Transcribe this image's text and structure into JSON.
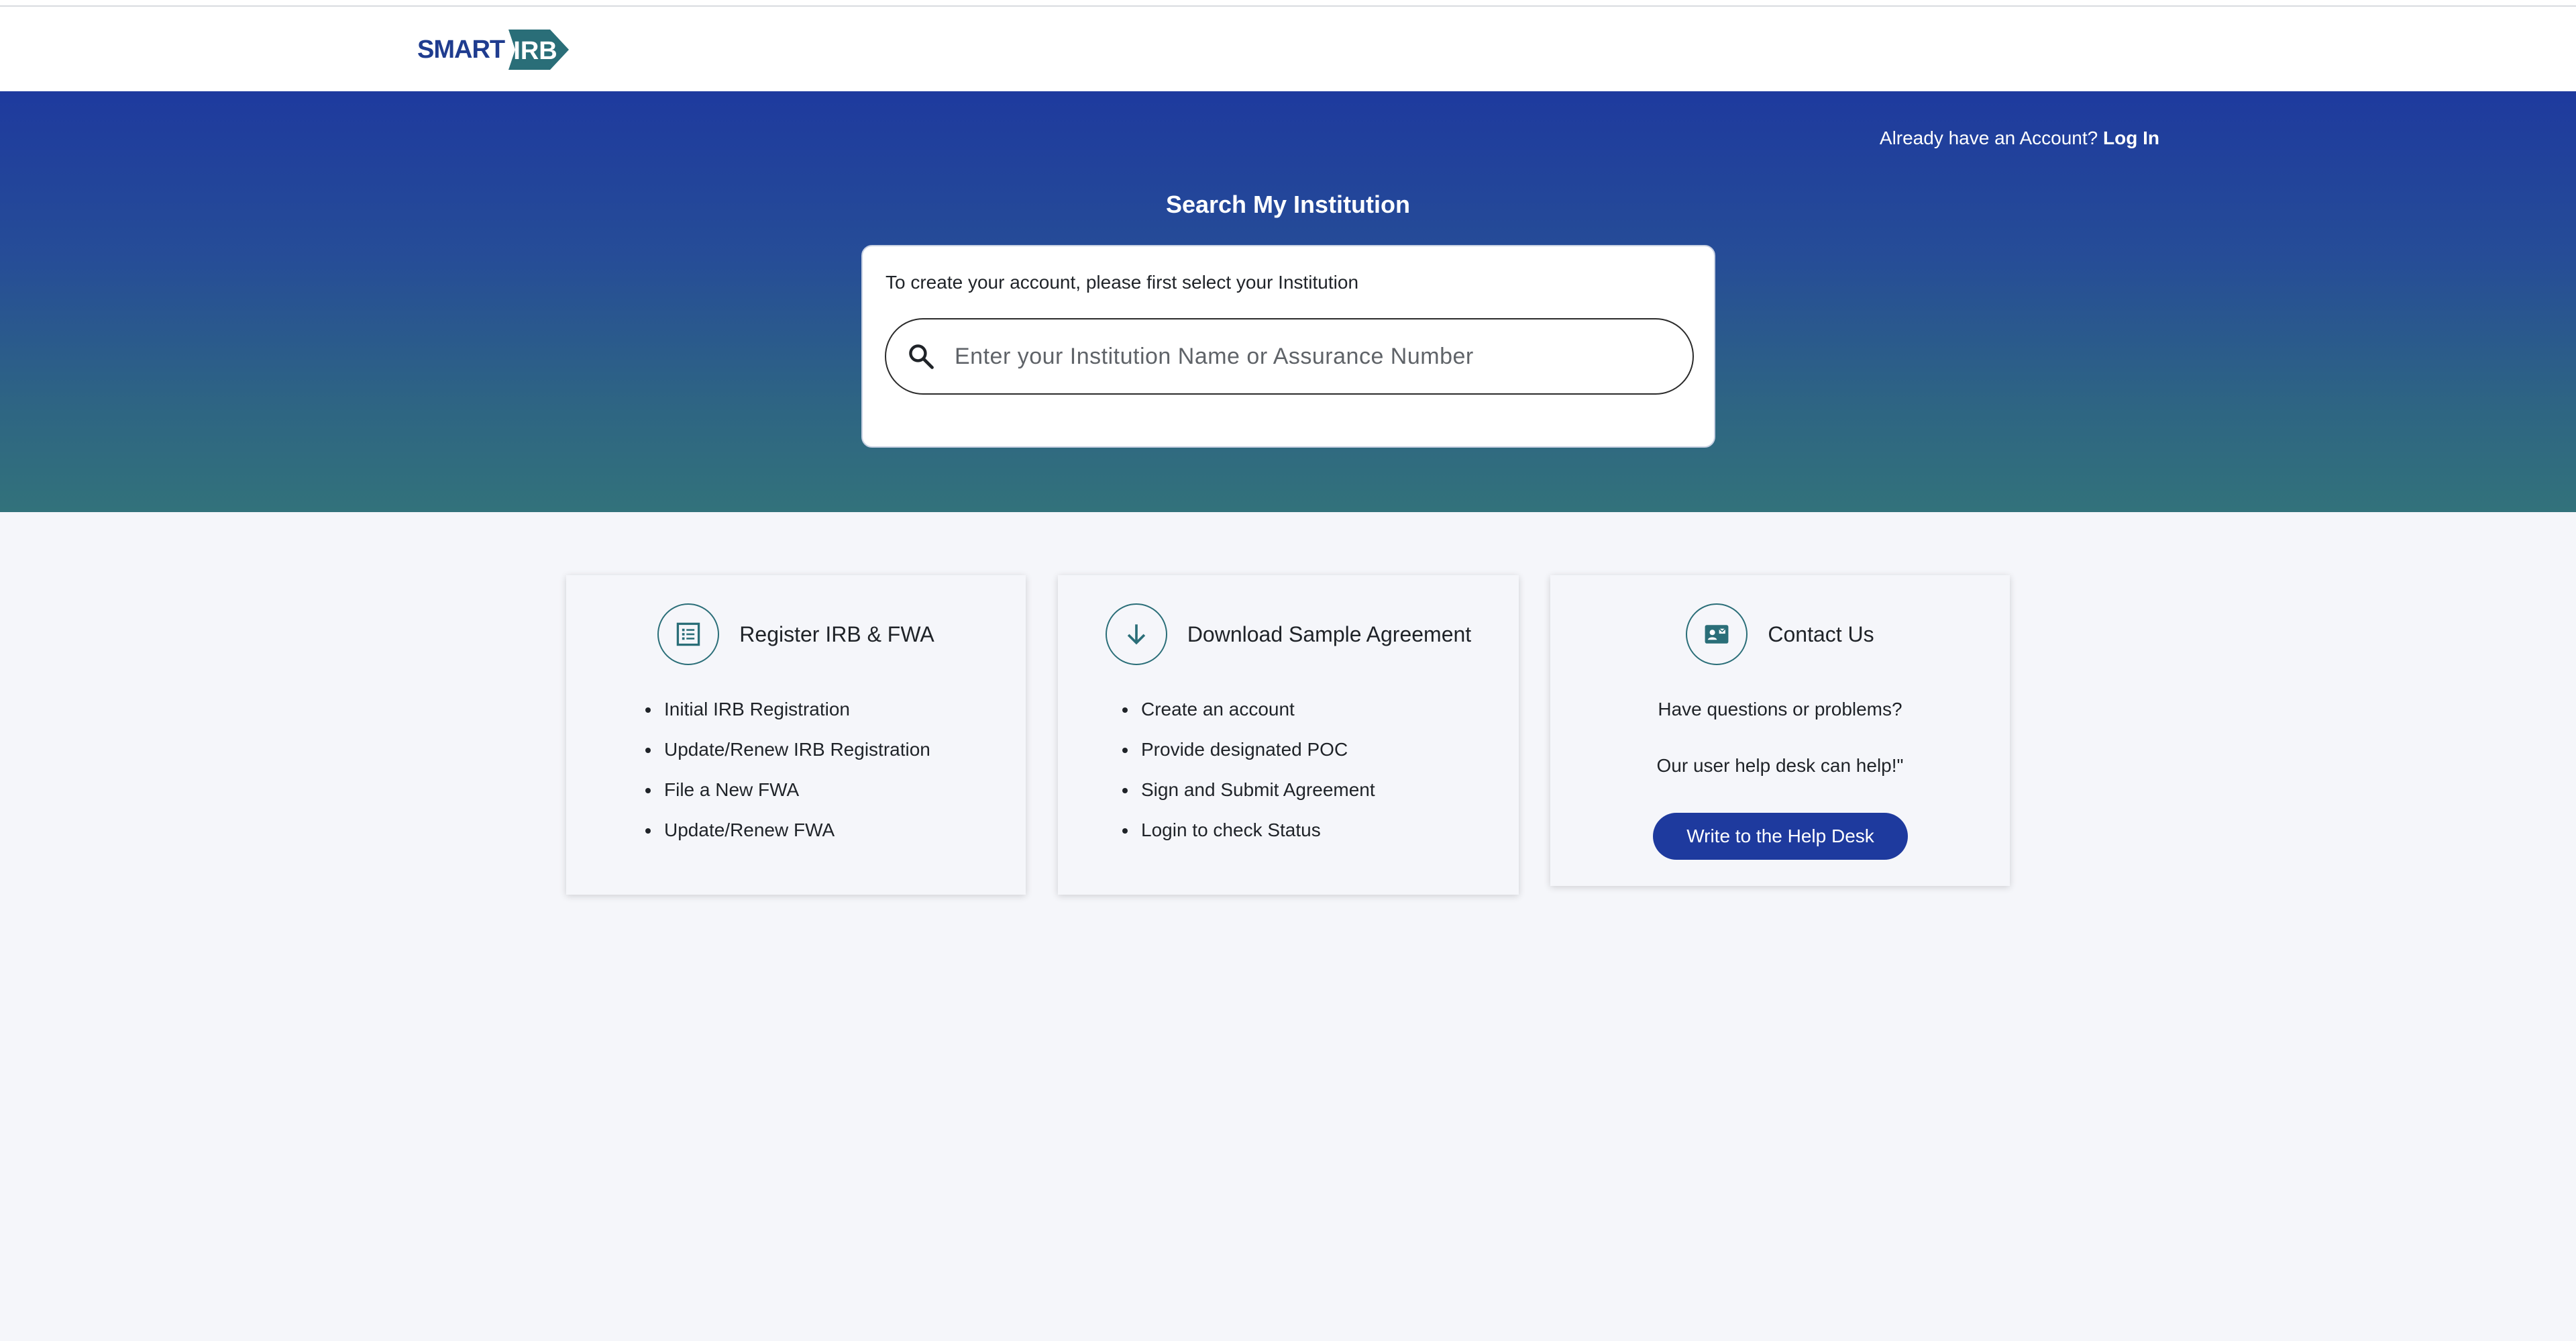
{
  "header": {
    "logo_text": "SMART",
    "logo_mark_text": "IRB"
  },
  "hero": {
    "login_prompt": "Already have an Account?",
    "login_link": "Log In",
    "title": "Search My Institution",
    "search_hint": "To create your account, please first select your Institution",
    "search_placeholder": "Enter your Institution Name or Assurance Number",
    "search_value": ""
  },
  "cards": {
    "register": {
      "title": "Register IRB & FWA",
      "icon": "list-icon",
      "items": [
        "Initial IRB Registration",
        "Update/Renew IRB Registration",
        "File a New FWA",
        "Update/Renew FWA"
      ]
    },
    "download": {
      "title": "Download Sample Agreement",
      "icon": "download-arrow-icon",
      "items": [
        "Create an account",
        "Provide designated POC",
        "Sign and Submit Agreement",
        "Login to check Status"
      ]
    },
    "contact": {
      "title": "Contact Us",
      "icon": "contact-card-icon",
      "question": "Have questions or problems?",
      "answer": "Our user help desk can help!\"",
      "button_label": "Write to the Help Desk"
    }
  },
  "colors": {
    "brand_blue": "#1e3a9e",
    "brand_teal": "#2a6e78",
    "page_bg": "#f5f6fa"
  }
}
